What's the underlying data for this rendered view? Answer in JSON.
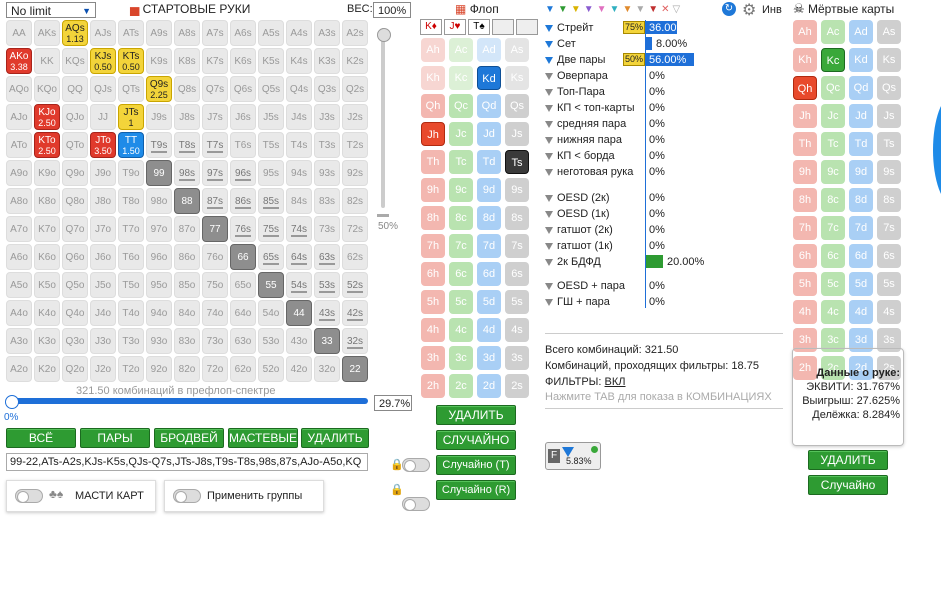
{
  "header": {
    "limit_select": "No limit",
    "starting_hands_title": "СТАРТОВЫЕ РУКИ",
    "weight_label": "ВЕС:",
    "weight_value": "100%",
    "flop_title": "Флоп",
    "inv_label": "Инв",
    "dead_cards_title": "Мёртвые карты"
  },
  "matrix": {
    "rows": [
      [
        {
          "t": "AA"
        },
        {
          "t": "AKs"
        },
        {
          "t": "AQs",
          "v": "1.13",
          "c": "yellow"
        },
        {
          "t": "AJs"
        },
        {
          "t": "ATs"
        },
        {
          "t": "A9s"
        },
        {
          "t": "A8s"
        },
        {
          "t": "A7s"
        },
        {
          "t": "A6s"
        },
        {
          "t": "A5s"
        },
        {
          "t": "A4s"
        },
        {
          "t": "A3s"
        },
        {
          "t": "A2s"
        }
      ],
      [
        {
          "t": "AKo",
          "v": "3.38",
          "c": "red"
        },
        {
          "t": "KK"
        },
        {
          "t": "KQs"
        },
        {
          "t": "KJs",
          "v": "0.50",
          "c": "yellow"
        },
        {
          "t": "KTs",
          "v": "0.50",
          "c": "yellow"
        },
        {
          "t": "K9s"
        },
        {
          "t": "K8s"
        },
        {
          "t": "K7s"
        },
        {
          "t": "K6s"
        },
        {
          "t": "K5s"
        },
        {
          "t": "K4s"
        },
        {
          "t": "K3s"
        },
        {
          "t": "K2s"
        }
      ],
      [
        {
          "t": "AQo"
        },
        {
          "t": "KQo"
        },
        {
          "t": "QQ"
        },
        {
          "t": "QJs"
        },
        {
          "t": "QTs"
        },
        {
          "t": "Q9s",
          "v": "2.25",
          "c": "yellow"
        },
        {
          "t": "Q8s"
        },
        {
          "t": "Q7s"
        },
        {
          "t": "Q6s"
        },
        {
          "t": "Q5s"
        },
        {
          "t": "Q4s"
        },
        {
          "t": "Q3s"
        },
        {
          "t": "Q2s"
        }
      ],
      [
        {
          "t": "AJo"
        },
        {
          "t": "KJo",
          "v": "2.50",
          "c": "red"
        },
        {
          "t": "QJo"
        },
        {
          "t": "JJ"
        },
        {
          "t": "JTs",
          "v": "1",
          "c": "yellow"
        },
        {
          "t": "J9s"
        },
        {
          "t": "J8s"
        },
        {
          "t": "J7s"
        },
        {
          "t": "J6s"
        },
        {
          "t": "J5s"
        },
        {
          "t": "J4s"
        },
        {
          "t": "J3s"
        },
        {
          "t": "J2s"
        }
      ],
      [
        {
          "t": "ATo"
        },
        {
          "t": "KTo",
          "v": "2.50",
          "c": "red"
        },
        {
          "t": "QTo"
        },
        {
          "t": "JTo",
          "v": "3.50",
          "c": "red"
        },
        {
          "t": "TT",
          "v": "1.50",
          "c": "blue"
        },
        {
          "t": "T9s"
        },
        {
          "t": "T8s"
        },
        {
          "t": "T7s"
        },
        {
          "t": "T6s"
        },
        {
          "t": "T5s"
        },
        {
          "t": "T4s"
        },
        {
          "t": "T3s"
        },
        {
          "t": "T2s"
        }
      ],
      [
        {
          "t": "A9o"
        },
        {
          "t": "K9o"
        },
        {
          "t": "Q9o"
        },
        {
          "t": "J9o"
        },
        {
          "t": "T9o"
        },
        {
          "t": "99",
          "c": "gray"
        },
        {
          "t": "98s"
        },
        {
          "t": "97s"
        },
        {
          "t": "96s"
        },
        {
          "t": "95s"
        },
        {
          "t": "94s"
        },
        {
          "t": "93s"
        },
        {
          "t": "92s"
        }
      ],
      [
        {
          "t": "A8o"
        },
        {
          "t": "K8o"
        },
        {
          "t": "Q8o"
        },
        {
          "t": "J8o"
        },
        {
          "t": "T8o"
        },
        {
          "t": "98o"
        },
        {
          "t": "88",
          "c": "gray"
        },
        {
          "t": "87s"
        },
        {
          "t": "86s"
        },
        {
          "t": "85s"
        },
        {
          "t": "84s"
        },
        {
          "t": "83s"
        },
        {
          "t": "82s"
        }
      ],
      [
        {
          "t": "A7o"
        },
        {
          "t": "K7o"
        },
        {
          "t": "Q7o"
        },
        {
          "t": "J7o"
        },
        {
          "t": "T7o"
        },
        {
          "t": "97o"
        },
        {
          "t": "87o"
        },
        {
          "t": "77",
          "c": "gray"
        },
        {
          "t": "76s"
        },
        {
          "t": "75s"
        },
        {
          "t": "74s"
        },
        {
          "t": "73s"
        },
        {
          "t": "72s"
        }
      ],
      [
        {
          "t": "A6o"
        },
        {
          "t": "K6o"
        },
        {
          "t": "Q6o"
        },
        {
          "t": "J6o"
        },
        {
          "t": "T6o"
        },
        {
          "t": "96o"
        },
        {
          "t": "86o"
        },
        {
          "t": "76o"
        },
        {
          "t": "66",
          "c": "gray"
        },
        {
          "t": "65s"
        },
        {
          "t": "64s"
        },
        {
          "t": "63s"
        },
        {
          "t": "62s"
        }
      ],
      [
        {
          "t": "A5o"
        },
        {
          "t": "K5o"
        },
        {
          "t": "Q5o"
        },
        {
          "t": "J5o"
        },
        {
          "t": "T5o"
        },
        {
          "t": "95o"
        },
        {
          "t": "85o"
        },
        {
          "t": "75o"
        },
        {
          "t": "65o"
        },
        {
          "t": "55",
          "c": "gray"
        },
        {
          "t": "54s"
        },
        {
          "t": "53s"
        },
        {
          "t": "52s"
        }
      ],
      [
        {
          "t": "A4o"
        },
        {
          "t": "K4o"
        },
        {
          "t": "Q4o"
        },
        {
          "t": "J4o"
        },
        {
          "t": "T4o"
        },
        {
          "t": "94o"
        },
        {
          "t": "84o"
        },
        {
          "t": "74o"
        },
        {
          "t": "64o"
        },
        {
          "t": "54o"
        },
        {
          "t": "44",
          "c": "gray"
        },
        {
          "t": "43s"
        },
        {
          "t": "42s"
        }
      ],
      [
        {
          "t": "A3o"
        },
        {
          "t": "K3o"
        },
        {
          "t": "Q3o"
        },
        {
          "t": "J3o"
        },
        {
          "t": "T3o"
        },
        {
          "t": "93o"
        },
        {
          "t": "83o"
        },
        {
          "t": "73o"
        },
        {
          "t": "63o"
        },
        {
          "t": "53o"
        },
        {
          "t": "43o"
        },
        {
          "t": "33",
          "c": "gray"
        },
        {
          "t": "32s"
        }
      ],
      [
        {
          "t": "A2o"
        },
        {
          "t": "K2o"
        },
        {
          "t": "Q2o"
        },
        {
          "t": "J2o"
        },
        {
          "t": "T2o"
        },
        {
          "t": "92o"
        },
        {
          "t": "82o"
        },
        {
          "t": "72o"
        },
        {
          "t": "62o"
        },
        {
          "t": "52o"
        },
        {
          "t": "42o"
        },
        {
          "t": "32o"
        },
        {
          "t": "22",
          "c": "gray"
        }
      ]
    ],
    "combos_caption": "321.50 комбинаций в префлоп-спектре",
    "slider_left": "0%",
    "slider_right": "29.7%",
    "vslider_label": "50%"
  },
  "buttons": {
    "all": "ВСЁ",
    "pairs": "ПАРЫ",
    "broadway": "БРОДВЕЙ",
    "suited": "МАСТЕВЫЕ",
    "delete": "УДАЛИТЬ",
    "flop_delete": "УДАЛИТЬ",
    "flop_random": "СЛУЧАЙНО",
    "flop_random_t": "Случайно (T)",
    "flop_random_r": "Случайно (R)",
    "dead_delete": "УДАЛИТЬ",
    "dead_random": "Случайно"
  },
  "range_text": "99-22,ATs-A2s,KJs-K5s,QJs-Q7s,JTs-J8s,T9s-T8s,98s,87s,AJo-A5o,KQ",
  "toggles": {
    "suits_label": "МАСТИ КАРТ",
    "groups_label": "Применить группы"
  },
  "flop": {
    "suit_tabs": [
      "K♦",
      "J♥",
      "T♠",
      "",
      ""
    ],
    "ranks": [
      "A",
      "K",
      "Q",
      "J",
      "T",
      "9",
      "8",
      "7",
      "6",
      "5",
      "4",
      "3",
      "2"
    ],
    "suits": [
      "h",
      "c",
      "d",
      "s"
    ],
    "selected": [
      "Jh",
      "Kd",
      "Ts"
    ]
  },
  "stats": {
    "rows": [
      {
        "name": "Стрейт",
        "badge": "75%",
        "pct": "36.00%",
        "fill": 0.36,
        "color": "blue"
      },
      {
        "name": "Сет",
        "badge": "",
        "pct": "8.00%",
        "fill": 0.08,
        "color": "blue"
      },
      {
        "name": "Две пары",
        "badge": "50%",
        "pct": "56.00%",
        "fill": 0.56,
        "color": "blue"
      },
      {
        "name": "Оверпара",
        "badge": "",
        "pct": "0%",
        "fill": 0,
        "color": "blue"
      },
      {
        "name": "Топ-Пара",
        "badge": "",
        "pct": "0%",
        "fill": 0,
        "color": "blue"
      },
      {
        "name": "КП < топ-карты",
        "badge": "",
        "pct": "0%",
        "fill": 0,
        "color": "blue"
      },
      {
        "name": "средняя пара",
        "badge": "",
        "pct": "0%",
        "fill": 0,
        "color": "blue"
      },
      {
        "name": "нижняя пара",
        "badge": "",
        "pct": "0%",
        "fill": 0,
        "color": "blue"
      },
      {
        "name": "КП < борда",
        "badge": "",
        "pct": "0%",
        "fill": 0,
        "color": "blue"
      },
      {
        "name": "неготовая рука",
        "badge": "",
        "pct": "0%",
        "fill": 0,
        "color": "blue"
      }
    ],
    "draw_rows": [
      {
        "name": "OESD (2к)",
        "pct": "0%",
        "fill": 0
      },
      {
        "name": "OESD (1к)",
        "pct": "0%",
        "fill": 0
      },
      {
        "name": "гатшот (2к)",
        "pct": "0%",
        "fill": 0
      },
      {
        "name": "гатшот (1к)",
        "pct": "0%",
        "fill": 0
      },
      {
        "name": "2к БДФД",
        "pct": "20.00%",
        "fill": 0.2
      }
    ],
    "combo_rows": [
      {
        "name": "OESD + пара",
        "pct": "0%",
        "fill": 0
      },
      {
        "name": "ГШ + пара",
        "pct": "0%",
        "fill": 0
      }
    ],
    "total_combos": "Всего комбинаций: 321.50",
    "passing_combos": "Комбинаций, проходящих фильтры: 18.75",
    "filters_label": "ФИЛЬТРЫ:",
    "filters_value": "ВКЛ",
    "tab_hint": "Нажмите TAB для показа в КОМБИНАЦИЯХ",
    "filter_badge_pct": "5.83%"
  },
  "hand_data": {
    "title": "Данные о руке:",
    "equity": "ЭКВИТИ: 31.767%",
    "win": "Выигрыш: 27.625%",
    "split": "Делёжка: 8.284%"
  },
  "dead": {
    "selected": [
      "Kc",
      "Qh"
    ]
  },
  "colors": {
    "accent_green": "#2e9b32",
    "accent_blue": "#1e78d8",
    "hand_red": "#e03a2c",
    "hand_yellow": "#f3d43a"
  }
}
